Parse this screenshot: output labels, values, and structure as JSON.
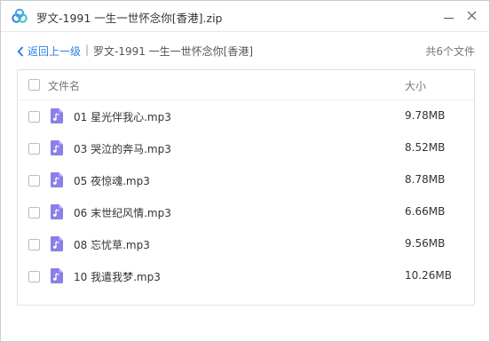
{
  "window": {
    "title": "罗文-1991 一生一世怀念你[香港].zip",
    "logo_icon": "cloud-icon",
    "minimize_icon": "minimize-icon",
    "close_icon": "close-icon"
  },
  "nav": {
    "back_label": "返回上一级",
    "separator": "|",
    "current_folder": "罗文-1991 一生一世怀念你[香港]",
    "file_count": "共6个文件"
  },
  "table": {
    "col_name": "文件名",
    "col_size": "大小",
    "rows": [
      {
        "name": "01 星光伴我心.mp3",
        "size": "9.78MB"
      },
      {
        "name": "03 哭泣的奔马.mp3",
        "size": "8.52MB"
      },
      {
        "name": "05 夜惊魂.mp3",
        "size": "8.78MB"
      },
      {
        "name": "06 末世纪风情.mp3",
        "size": "6.66MB"
      },
      {
        "name": "08 忘忧草.mp3",
        "size": "9.56MB"
      },
      {
        "name": "10 我遣我梦.mp3",
        "size": "10.26MB"
      }
    ]
  },
  "colors": {
    "accent": "#2f7fe0",
    "file_icon": "#8b7fe8"
  }
}
